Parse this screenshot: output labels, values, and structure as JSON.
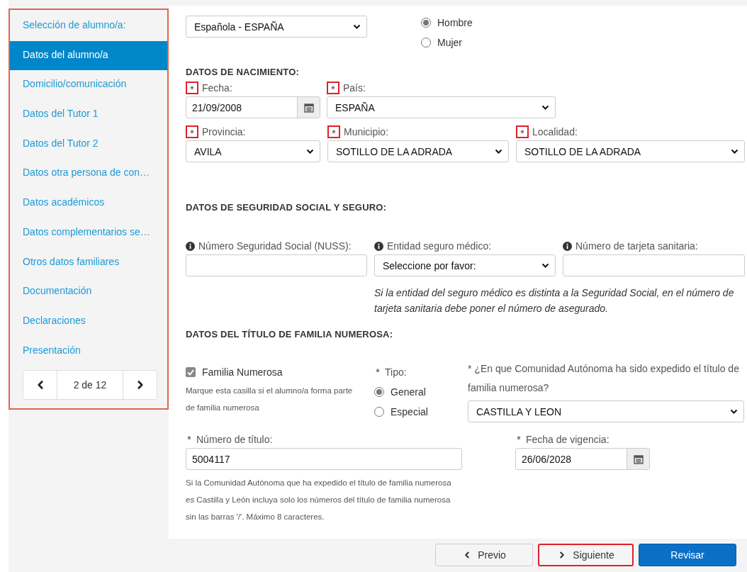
{
  "sidebar": {
    "highlighted": true,
    "items": [
      {
        "label": "Selección de alumno/a:",
        "selected": false
      },
      {
        "label": "Datos del alumno/a",
        "selected": true
      },
      {
        "label": "Domicilio/comunicación",
        "selected": false
      },
      {
        "label": "Datos del Tutor 1",
        "selected": false
      },
      {
        "label": "Datos del Tutor 2",
        "selected": false
      },
      {
        "label": "Datos otra persona de con…",
        "selected": false
      },
      {
        "label": "Datos académicos",
        "selected": false
      },
      {
        "label": "Datos complementarios se…",
        "selected": false
      },
      {
        "label": "Otros datos familiares",
        "selected": false
      },
      {
        "label": "Documentación",
        "selected": false
      },
      {
        "label": "Declaraciones",
        "selected": false
      },
      {
        "label": "Presentación",
        "selected": false
      }
    ],
    "pager": {
      "label": "2 de 12"
    }
  },
  "nationality": {
    "value": "Española - ESPAÑA"
  },
  "sex": [
    {
      "label": "Hombre",
      "selected": true
    },
    {
      "label": "Mujer",
      "selected": false
    }
  ],
  "birth": {
    "heading": "DATOS DE NACIMIENTO:",
    "rows": [
      [
        {
          "kind": "date",
          "mark": "*",
          "highlighted": true,
          "label": "Fecha:",
          "value": "21/09/2008"
        },
        {
          "kind": "select",
          "mark": "*",
          "highlighted": true,
          "label": "País:",
          "value": "ESPAÑA"
        }
      ],
      [
        {
          "kind": "select",
          "mark": "*",
          "highlighted": true,
          "label": "Provincia:",
          "value": "AVILA"
        },
        {
          "kind": "select",
          "mark": "*",
          "highlighted": true,
          "label": "Municipio:",
          "value": "SOTILLO DE LA ADRADA"
        },
        {
          "kind": "select",
          "mark": "*",
          "highlighted": true,
          "label": "Localidad:",
          "value": "SOTILLO DE LA ADRADA"
        }
      ]
    ]
  },
  "insurance": {
    "heading": "DATOS DE SEGURIDAD SOCIAL Y SEGURO:",
    "fields": [
      {
        "kind": "text",
        "info": true,
        "label": "Número Seguridad Social (NUSS):"
      },
      {
        "kind": "select",
        "info": true,
        "label": "Entidad seguro médico:",
        "value": "Seleccione por favor:"
      },
      {
        "kind": "text",
        "info": true,
        "label": "Número de tarjeta sanitaria:"
      }
    ],
    "note": "Si la entidad del seguro médico es distinta a la Seguridad Social, en el número de tarjeta sanitaria debe poner el número de asegurado."
  },
  "large_family": {
    "heading": "DATOS DEL TÍTULO DE FAMILIA NUMEROSA:",
    "checkbox": {
      "label": "Familia Numerosa",
      "checked": true,
      "help": "Marque esta casilla si el alumno/a forma parte de familia numerosa"
    },
    "type": {
      "mark": "*",
      "label": "Tipo:",
      "options": [
        {
          "label": "General",
          "selected": true
        },
        {
          "label": "Especial",
          "selected": false
        }
      ]
    },
    "community": {
      "kind": "select",
      "mark": "*",
      "label": "¿En que Comunidad Autónoma ha sido expedido el título de familia numerosa?",
      "value": "CASTILLA Y LEON"
    },
    "number": {
      "kind": "text",
      "mark": "*",
      "label": "Número de título:",
      "value": "5004117"
    },
    "number_help": "Si la Comunidad Autónoma que ha expedido el título de familia numerosa es Castilla y León incluya solo los números del título de familia numerosa sin las barras '/'. Máximo 8 caracteres.",
    "validity": {
      "kind": "date",
      "mark": "*",
      "label": "Fecha de vigencia:",
      "value": "26/06/2028"
    }
  },
  "buttons": [
    {
      "kind": "prev",
      "label": "Previo",
      "highlighted": false
    },
    {
      "kind": "next",
      "label": "Siguiente",
      "highlighted": true
    },
    {
      "kind": "primary",
      "label": "Revisar",
      "highlighted": false
    }
  ]
}
